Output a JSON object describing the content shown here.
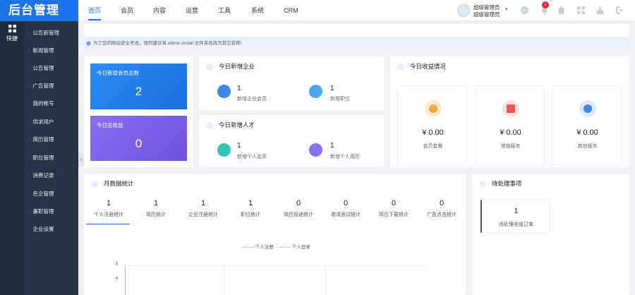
{
  "brand": "后台管理",
  "rail": {
    "label": "快捷"
  },
  "menu": [
    "公告新管理",
    "新闻管理",
    "公告管理",
    "广告管理",
    "我的帐号",
    "供求用户",
    "简历管理",
    "职位管理",
    "消费记录",
    "名企管理",
    "兼职管理",
    "企业设置"
  ],
  "topnav": [
    "首页",
    "会员",
    "内容",
    "运营",
    "工具",
    "系统",
    "CRM"
  ],
  "user": {
    "line1": "超级管理员",
    "line2": "超级管理员",
    "notif_count": "1"
  },
  "notice": "为了您的网站安全考虑，强烈建议将 admin,install 文件夹名改为其它名称!",
  "tiles": {
    "members_title": "今日新增会员总数",
    "members_value": "2",
    "income_title": "今日总收益",
    "income_value": "0"
  },
  "company_card": {
    "title": "今日新增企业",
    "stats": [
      {
        "num": "1",
        "label": "新增企业会员"
      },
      {
        "num": "1",
        "label": "新增职位"
      }
    ]
  },
  "talent_card": {
    "title": "今日新增人才",
    "stats": [
      {
        "num": "1",
        "label": "新增个人会员"
      },
      {
        "num": "1",
        "label": "新增个人简历"
      }
    ]
  },
  "earnings": {
    "title": "今日收益情况",
    "items": [
      {
        "value": "¥ 0.00",
        "label": "会员套餐",
        "color": "#f7a93c"
      },
      {
        "value": "¥ 0.00",
        "label": "增值服务",
        "color": "#f0545a"
      },
      {
        "value": "¥ 0.00",
        "label": "其他服务",
        "color": "#3e86e8"
      }
    ]
  },
  "monthly": {
    "title": "月数据统计",
    "items": [
      {
        "num": "1",
        "label": "个人注册统计"
      },
      {
        "num": "1",
        "label": "简历统计"
      },
      {
        "num": "1",
        "label": "企业注册统计"
      },
      {
        "num": "1",
        "label": "职位统计"
      },
      {
        "num": "0",
        "label": "简历投递统计"
      },
      {
        "num": "0",
        "label": "邀请面试统计"
      },
      {
        "num": "0",
        "label": "简历下载统计"
      },
      {
        "num": "0",
        "label": "广告点击统计"
      }
    ],
    "legend": [
      "个人注册",
      "个人登录"
    ],
    "yticks": [
      "5",
      "4"
    ]
  },
  "pending": {
    "title": "待处理事项",
    "num": "1",
    "label": "待处理充值订单"
  }
}
